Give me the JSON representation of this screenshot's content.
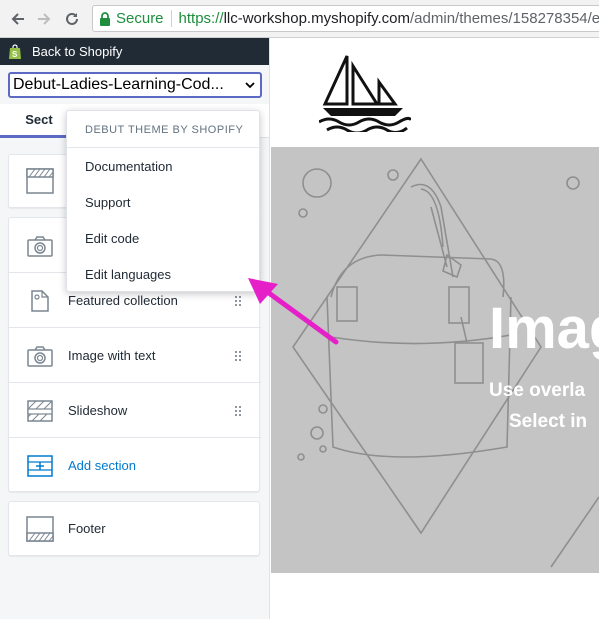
{
  "browser": {
    "secure_label": "Secure",
    "url_protocol": "https://",
    "url_host": "llc-workshop.myshopify.com",
    "url_path": "/admin/themes/158278354/e"
  },
  "sidebar": {
    "back_label": "Back to Shopify",
    "theme_name": "Debut-Ladies-Learning-Cod...",
    "tab_label": "Sect",
    "sections": [
      {
        "label": "Featured collection",
        "icon": "tag-icon"
      },
      {
        "label": "Image with text",
        "icon": "camera-icon"
      },
      {
        "label": "Slideshow",
        "icon": "slideshow-icon"
      }
    ],
    "add_section_label": "Add section",
    "footer_label": "Footer"
  },
  "menu": {
    "heading": "DEBUT THEME BY SHOPIFY",
    "items": [
      "Documentation",
      "Support",
      "Edit code",
      "Edit languages"
    ]
  },
  "preview": {
    "hero_title": "Imag",
    "hero_sub1": "Use overla",
    "hero_sub2": "Select in"
  },
  "colors": {
    "accent": "#5c6ac4",
    "link": "#007ace",
    "arrow": "#e620c9",
    "secure": "#1e8e3e"
  }
}
